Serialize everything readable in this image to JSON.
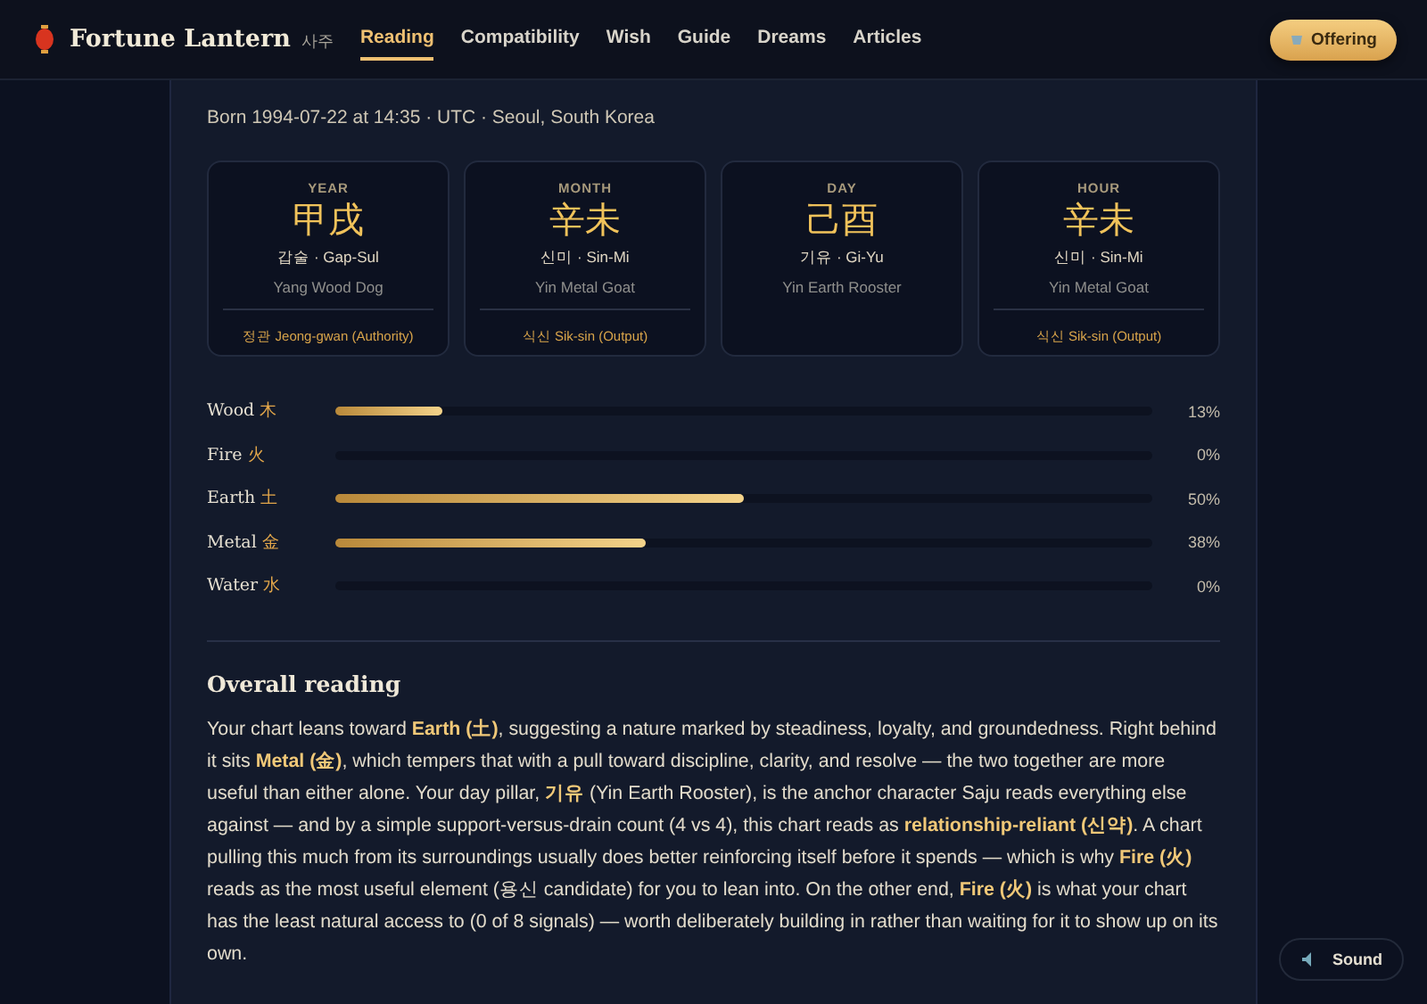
{
  "brand": {
    "name": "Fortune Lantern",
    "tag": "사주"
  },
  "nav": [
    {
      "label": "Reading",
      "selected": true
    },
    {
      "label": "Compatibility",
      "selected": false
    },
    {
      "label": "Wish",
      "selected": false
    },
    {
      "label": "Guide",
      "selected": false
    },
    {
      "label": "Dreams",
      "selected": false
    },
    {
      "label": "Articles",
      "selected": false
    }
  ],
  "offering_button": "Offering",
  "birth_info": "Born 1994-07-22 at 14:35 · UTC · Seoul, South Korea",
  "pillars": [
    {
      "label": "YEAR",
      "hanja": "甲戌",
      "reading": "갑술 · Gap-Sul",
      "meaning": "Yang Wood Dog",
      "ten_god": "정관 Jeong-gwan (Authority)"
    },
    {
      "label": "MONTH",
      "hanja": "辛未",
      "reading": "신미 · Sin-Mi",
      "meaning": "Yin Metal Goat",
      "ten_god": "식신 Sik-sin (Output)"
    },
    {
      "label": "DAY",
      "hanja": "己酉",
      "reading": "기유 · Gi-Yu",
      "meaning": "Yin Earth Rooster"
    },
    {
      "label": "HOUR",
      "hanja": "辛未",
      "reading": "신미 · Sin-Mi",
      "meaning": "Yin Metal Goat",
      "ten_god": "식신 Sik-sin (Output)"
    }
  ],
  "elements": [
    {
      "name": "Wood",
      "hanja": "木",
      "level": 0.13,
      "percent": "13%"
    },
    {
      "name": "Fire",
      "hanja": "火",
      "level": 0,
      "percent": "0%"
    },
    {
      "name": "Earth",
      "hanja": "土",
      "level": 0.5,
      "percent": "50%"
    },
    {
      "name": "Metal",
      "hanja": "金",
      "level": 0.38,
      "percent": "38%"
    },
    {
      "name": "Water",
      "hanja": "水",
      "level": 0,
      "percent": "0%"
    }
  ],
  "reading": {
    "heading": "Overall reading",
    "text": "Your chart leans toward **Earth (土)**, suggesting a nature marked by steadiness, loyalty, and groundedness. Right behind it sits **Metal (金)**, which tempers that with a pull toward discipline, clarity, and resolve — the two together are more useful than either alone. Your day pillar, **기유** (Yin Earth Rooster), is the anchor character Saju reads everything else against — and by a simple support-versus-drain count (4 vs 4), this chart reads as **relationship-reliant (신약)**. A chart pulling this much from its surroundings usually does better reinforcing itself before it spends — which is why **Fire (火)** reads as the most useful element (용신 candidate) for you to lean into. On the other end, **Fire (火)** is what your chart has the least natural access to (0 of 8 signals) — worth deliberately building in rather than waiting for it to show up on its own."
  },
  "sound_button": "Sound"
}
